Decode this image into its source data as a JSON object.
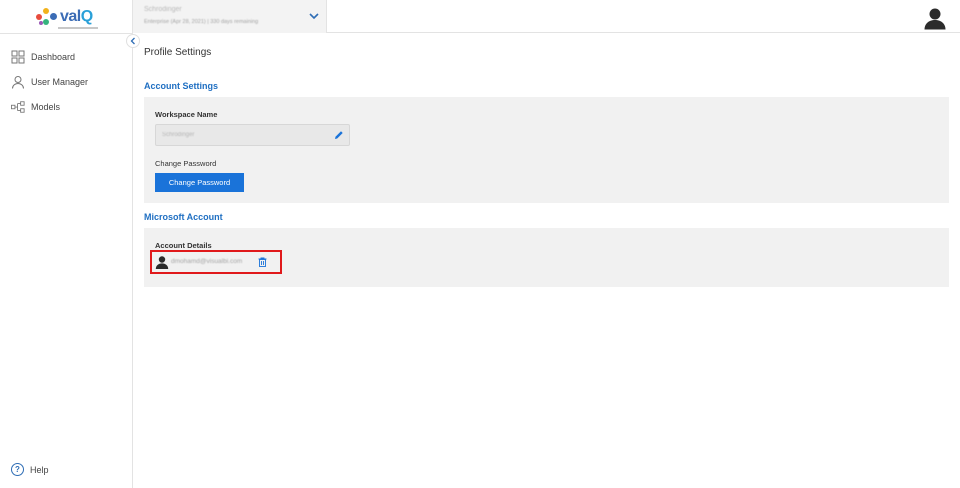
{
  "app": {
    "brand": "valQ",
    "brand_main": "val",
    "brand_accent": "Q",
    "accent_color": "#1a73d9"
  },
  "sidebar": {
    "items": [
      {
        "label": "Dashboard",
        "icon": "dashboard-grid-icon"
      },
      {
        "label": "User Manager",
        "icon": "user-icon"
      },
      {
        "label": "Models",
        "icon": "models-network-icon"
      }
    ],
    "help_label": "Help",
    "help_icon_glyph": "?"
  },
  "topbar": {
    "workspace_name": "Schrodinger",
    "workspace_plan": "Enterprise (Apr 28, 2021) | 330 days remaining"
  },
  "main": {
    "page_title": "Profile Settings",
    "account_settings": {
      "title": "Account Settings",
      "workspace_name_label": "Workspace Name",
      "workspace_name_value": "Schrodinger",
      "change_password_label": "Change Password",
      "change_password_button": "Change Password"
    },
    "microsoft_account": {
      "title": "Microsoft Account",
      "account_details_label": "Account Details",
      "email": "dmohamd@visualbi.com"
    }
  }
}
